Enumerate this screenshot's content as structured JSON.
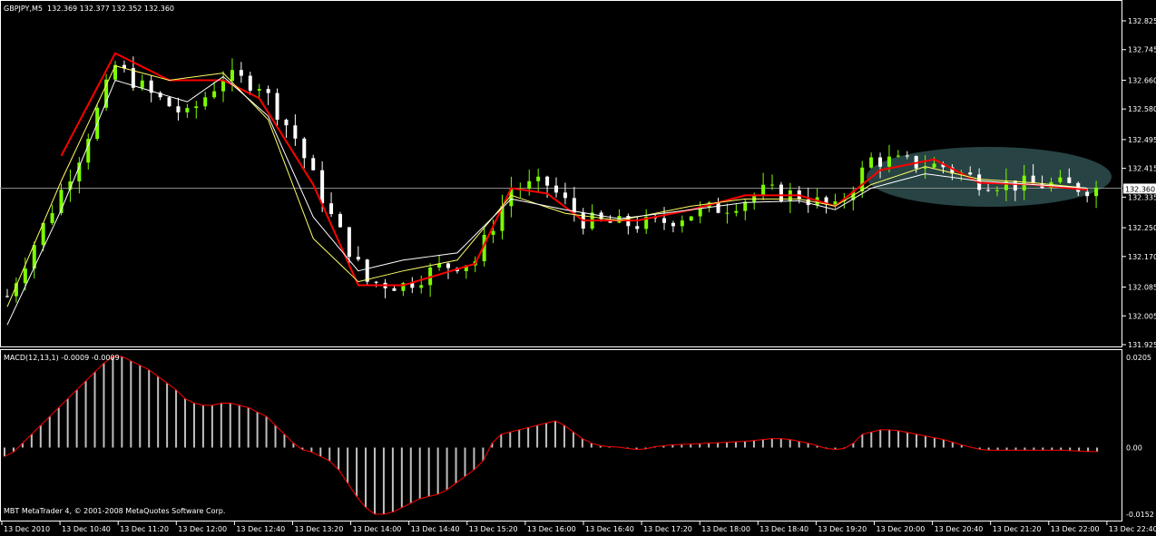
{
  "header": {
    "symbol_label": "GBPJPY,M5",
    "ohlc_label": "132.369 132.377 132.352 132.360"
  },
  "macd": {
    "label": "MACD(12,13,1) -0.0009 -0.0009"
  },
  "footer": {
    "copyright": "MBT MetaTrader 4, © 2001-2008 MetaQuotes Software Corp."
  },
  "colors": {
    "background": "#000000",
    "bull_candle": "#7CFC00",
    "bear_candle": "#FFFFFF",
    "ma_red": "#FF0000",
    "ma_blue": "#3366FF",
    "ma_yellow": "#FFFF66",
    "ma_white": "#FFFFFF",
    "macd_hist": "#C0C0C0",
    "macd_signal": "#FF0000",
    "highlight_ellipse": "#2F4F4F"
  },
  "chart_data": [
    {
      "type": "candlestick",
      "symbol": "GBPJPY",
      "timeframe": "M5",
      "ylim": [
        131.925,
        132.825
      ],
      "y_ticks": [
        "132.825",
        "132.745",
        "132.660",
        "132.580",
        "132.495",
        "132.415",
        "132.335",
        "132.250",
        "132.170",
        "132.085",
        "132.005",
        "131.925"
      ],
      "current_price": "132.360",
      "current_price_value": 132.36,
      "x_ticks": [
        "13 Dec 2010",
        "13 Dec 10:40",
        "13 Dec 11:20",
        "13 Dec 12:00",
        "13 Dec 12:40",
        "13 Dec 13:20",
        "13 Dec 14:00",
        "13 Dec 14:40",
        "13 Dec 15:20",
        "13 Dec 16:00",
        "13 Dec 16:40",
        "13 Dec 17:20",
        "13 Dec 18:00",
        "13 Dec 18:40",
        "13 Dec 19:20",
        "13 Dec 20:00",
        "13 Dec 20:40",
        "13 Dec 21:20",
        "13 Dec 22:00",
        "13 Dec 22:40"
      ],
      "price_path": [
        [
          0,
          132.06
        ],
        [
          8,
          132.45
        ],
        [
          12,
          132.7
        ],
        [
          16,
          132.62
        ],
        [
          20,
          132.56
        ],
        [
          24,
          132.67
        ],
        [
          28,
          132.65
        ],
        [
          32,
          132.5
        ],
        [
          36,
          132.28
        ],
        [
          40,
          132.1
        ],
        [
          44,
          132.09
        ],
        [
          48,
          132.14
        ],
        [
          52,
          132.16
        ],
        [
          56,
          132.36
        ],
        [
          60,
          132.37
        ],
        [
          64,
          132.27
        ],
        [
          68,
          132.26
        ],
        [
          72,
          132.26
        ],
        [
          76,
          132.29
        ],
        [
          80,
          132.31
        ],
        [
          84,
          132.35
        ],
        [
          88,
          132.34
        ],
        [
          92,
          132.3
        ],
        [
          96,
          132.44
        ],
        [
          100,
          132.43
        ],
        [
          104,
          132.42
        ],
        [
          108,
          132.38
        ],
        [
          112,
          132.37
        ],
        [
          116,
          132.37
        ],
        [
          120,
          132.36
        ]
      ],
      "moving_averages": [
        {
          "color": "red",
          "path": [
            [
              6,
              132.45
            ],
            [
              12,
              132.735
            ],
            [
              18,
              132.66
            ],
            [
              24,
              132.66
            ],
            [
              28,
              132.61
            ],
            [
              34,
              132.37
            ],
            [
              39,
              132.09
            ],
            [
              44,
              132.09
            ],
            [
              52,
              132.15
            ],
            [
              56,
              132.36
            ],
            [
              60,
              132.345
            ],
            [
              64,
              132.27
            ],
            [
              70,
              132.27
            ],
            [
              76,
              132.3
            ],
            [
              82,
              132.34
            ],
            [
              88,
              132.34
            ],
            [
              92,
              132.31
            ],
            [
              97,
              132.41
            ],
            [
              103,
              132.44
            ],
            [
              108,
              132.375
            ],
            [
              114,
              132.37
            ],
            [
              120,
              132.355
            ]
          ]
        },
        {
          "color": "yellow",
          "path": [
            [
              0,
              132.03
            ],
            [
              6,
              132.38
            ],
            [
              12,
              132.7
            ],
            [
              18,
              132.66
            ],
            [
              24,
              132.68
            ],
            [
              29,
              132.55
            ],
            [
              34,
              132.22
            ],
            [
              39,
              132.1
            ],
            [
              44,
              132.13
            ],
            [
              50,
              132.16
            ],
            [
              56,
              132.34
            ],
            [
              62,
              132.29
            ],
            [
              68,
              132.27
            ],
            [
              76,
              132.31
            ],
            [
              82,
              132.33
            ],
            [
              88,
              132.33
            ],
            [
              92,
              132.31
            ],
            [
              96,
              132.37
            ],
            [
              102,
              132.42
            ],
            [
              108,
              132.385
            ],
            [
              114,
              132.375
            ],
            [
              120,
              132.36
            ]
          ]
        },
        {
          "color": "white",
          "path": [
            [
              0,
              131.98
            ],
            [
              6,
              132.3
            ],
            [
              12,
              132.66
            ],
            [
              16,
              132.63
            ],
            [
              20,
              132.6
            ],
            [
              24,
              132.67
            ],
            [
              29,
              132.56
            ],
            [
              34,
              132.28
            ],
            [
              39,
              132.13
            ],
            [
              44,
              132.16
            ],
            [
              50,
              132.18
            ],
            [
              56,
              132.33
            ],
            [
              62,
              132.3
            ],
            [
              68,
              132.275
            ],
            [
              76,
              132.3
            ],
            [
              82,
              132.32
            ],
            [
              88,
              132.325
            ],
            [
              92,
              132.3
            ],
            [
              96,
              132.36
            ],
            [
              102,
              132.4
            ],
            [
              108,
              132.38
            ],
            [
              114,
              132.37
            ],
            [
              120,
              132.36
            ]
          ]
        }
      ]
    },
    {
      "type": "bar",
      "title": "MACD(12,13,1) -0.0009 -0.0009",
      "ylim": [
        -0.0152,
        0.0205
      ],
      "y_ticks": [
        "0.0205",
        "0.00",
        "-0.0152"
      ],
      "series": [
        {
          "values": [
            -0.002,
            -0.001,
            0.001,
            0.003,
            0.005,
            0.007,
            0.009,
            0.011,
            0.013,
            0.015,
            0.017,
            0.019,
            0.0205,
            0.0205,
            0.0195,
            0.0185,
            0.0175,
            0.016,
            0.0145,
            0.013,
            0.011,
            0.01,
            0.0095,
            0.0095,
            0.01,
            0.01,
            0.0095,
            0.009,
            0.008,
            0.007,
            0.005,
            0.003,
            0.001,
            -0.0005,
            -0.001,
            -0.002,
            -0.003,
            -0.005,
            -0.008,
            -0.011,
            -0.0135,
            -0.015,
            -0.015,
            -0.0145,
            -0.0135,
            -0.0125,
            -0.0115,
            -0.011,
            -0.0105,
            -0.0095,
            -0.008,
            -0.0065,
            -0.005,
            -0.003,
            0.001,
            0.003,
            0.0035,
            0.004,
            0.0045,
            0.005,
            0.0055,
            0.006,
            0.005,
            0.0035,
            0.002,
            0.001,
            0.0004,
            0.0002,
            0.0001,
            -0.0002,
            -0.0004,
            -0.0003,
            0.0002,
            0.0004,
            0.0006,
            0.0007,
            0.0008,
            0.0009,
            0.001,
            0.0011,
            0.0012,
            0.0013,
            0.0014,
            0.0016,
            0.0018,
            0.002,
            0.002,
            0.0018,
            0.0014,
            0.001,
            0.0004,
            -0.0002,
            -0.0004,
            -0.0002,
            0.001,
            0.003,
            0.0035,
            0.004,
            0.004,
            0.0038,
            0.0034,
            0.003,
            0.0026,
            0.0022,
            0.0018,
            0.0012,
            0.0006,
            0.0001,
            -0.0004,
            -0.0006,
            -0.0006,
            -0.0006,
            -0.0006,
            -0.0006,
            -0.0006,
            -0.0006,
            -0.0006,
            -0.0006,
            -0.0007,
            -0.0008,
            -0.0009,
            -0.0009
          ]
        }
      ]
    }
  ]
}
